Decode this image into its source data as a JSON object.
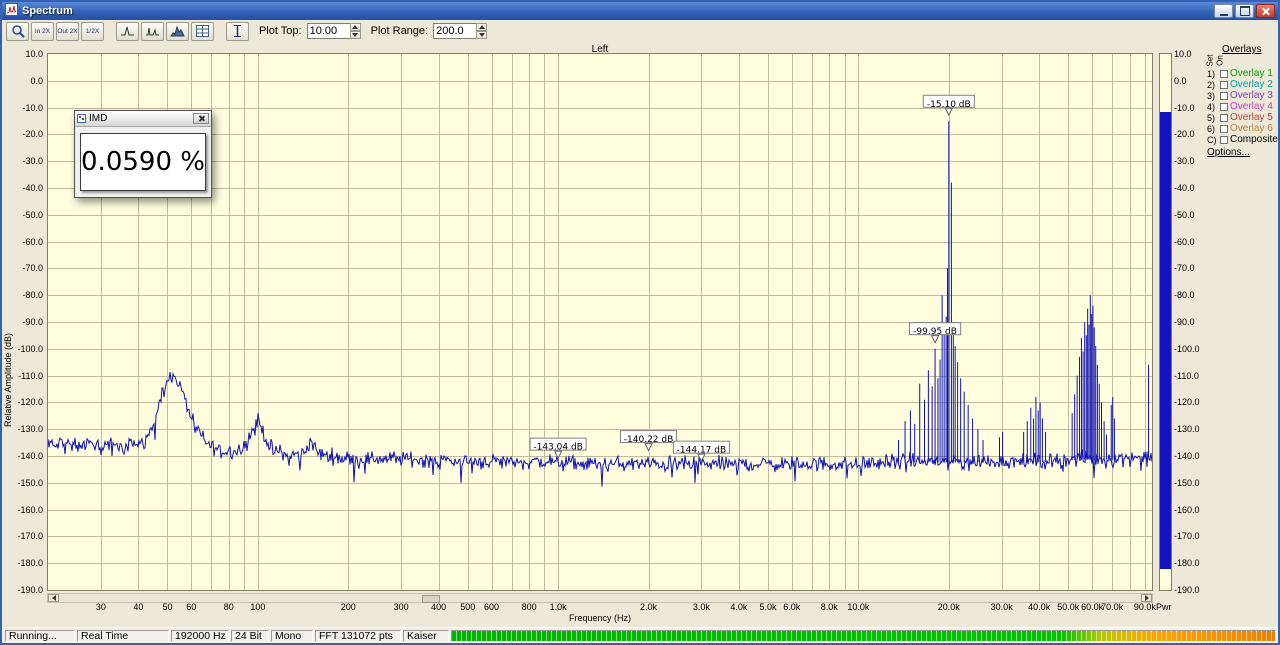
{
  "window": {
    "title": "Spectrum"
  },
  "icons": {
    "app": "spectrum-app-icon",
    "minimize": "minimize-icon",
    "maximize": "maximize-icon",
    "close": "close-icon",
    "zoom": "magnifier-icon",
    "zoom_in_2x": "magnifier-in-2x-icon",
    "zoom_out_2x": "magnifier-out-2x-icon",
    "zoom_half": "magnifier-half-icon",
    "peak_plot": "peak-curve-icon",
    "dual_peak_plot": "dual-peak-curve-icon",
    "filled_plot": "filled-curve-icon",
    "table": "data-table-icon",
    "cursor": "vertical-cursor-icon",
    "scroll_left": "arrow-left-icon",
    "scroll_right": "arrow-right-icon",
    "dialog_close": "close-icon"
  },
  "toolbar": {
    "zoom_in_label": "In 2X",
    "zoom_out_label": "Out 2X",
    "zoom_half_label": "1/2X",
    "plot_top_label": "Plot Top:",
    "plot_top_value": "10.00",
    "plot_range_label": "Plot Range:",
    "plot_range_value": "200.0"
  },
  "plot": {
    "title": "Left",
    "xlabel": "Frequency (Hz)",
    "ylabel": "Relative Amplitude (dB)",
    "pwr_label": "Pwr"
  },
  "imd_window": {
    "title": "IMD",
    "value": "0.0590 %"
  },
  "overlays": {
    "header": "Overlays",
    "col_set": "Set",
    "col_on": "On",
    "items": [
      {
        "num": "1)",
        "label": "Overlay 1",
        "color": "#00A000"
      },
      {
        "num": "2)",
        "label": "Overlay 2",
        "color": "#00A0A0"
      },
      {
        "num": "3)",
        "label": "Overlay 3",
        "color": "#8040C0"
      },
      {
        "num": "4)",
        "label": "Overlay 4",
        "color": "#C040C0"
      },
      {
        "num": "5)",
        "label": "Overlay 5",
        "color": "#C04040"
      },
      {
        "num": "6)",
        "label": "Overlay 6",
        "color": "#C08040"
      }
    ],
    "composite": {
      "num": "C)",
      "label": "Composite",
      "color": "#000000"
    },
    "options_label": "Options..."
  },
  "status": {
    "items": [
      "Running...",
      "Real Time",
      "192000 Hz",
      "24 Bit",
      "Mono",
      "FFT 131072 pts",
      "Kaiser"
    ]
  },
  "chart_data": {
    "type": "line",
    "title": "Left",
    "xlabel": "Frequency (Hz)",
    "ylabel": "Relative Amplitude (dB)",
    "xscale": "log",
    "xlim": [
      20,
      95000
    ],
    "ylim": [
      -190,
      10
    ],
    "plot_top_db": 10.0,
    "plot_range_db": 200.0,
    "grid": true,
    "colors": {
      "trace": "#1010B8",
      "grid": "#BEBE9C",
      "bg": "#FFFFE0",
      "power_bar": "#1212BE"
    },
    "y_ticks": [
      "10.0",
      "0.0",
      "-10.0",
      "-20.0",
      "-30.0",
      "-40.0",
      "-50.0",
      "-60.0",
      "-70.0",
      "-80.0",
      "-90.0",
      "-100.0",
      "-110.0",
      "-120.0",
      "-130.0",
      "-140.0",
      "-150.0",
      "-160.0",
      "-170.0",
      "-180.0",
      "-190.0"
    ],
    "x_ticks": [
      {
        "f": 30,
        "label": "30"
      },
      {
        "f": 40,
        "label": "40"
      },
      {
        "f": 50,
        "label": "50"
      },
      {
        "f": 60,
        "label": "60"
      },
      {
        "f": 80,
        "label": "80"
      },
      {
        "f": 100,
        "label": "100"
      },
      {
        "f": 200,
        "label": "200"
      },
      {
        "f": 300,
        "label": "300"
      },
      {
        "f": 400,
        "label": "400"
      },
      {
        "f": 500,
        "label": "500"
      },
      {
        "f": 600,
        "label": "600"
      },
      {
        "f": 800,
        "label": "800"
      },
      {
        "f": 1000,
        "label": "1.0k"
      },
      {
        "f": 2000,
        "label": "2.0k"
      },
      {
        "f": 3000,
        "label": "3.0k"
      },
      {
        "f": 4000,
        "label": "4.0k"
      },
      {
        "f": 5000,
        "label": "5.0k"
      },
      {
        "f": 6000,
        "label": "6.0k"
      },
      {
        "f": 8000,
        "label": "8.0k"
      },
      {
        "f": 10000,
        "label": "10.0k"
      },
      {
        "f": 20000,
        "label": "20.0k"
      },
      {
        "f": 30000,
        "label": "30.0k"
      },
      {
        "f": 40000,
        "label": "40.0k"
      },
      {
        "f": 50000,
        "label": "50.0k"
      },
      {
        "f": 60000,
        "label": "60.0k"
      },
      {
        "f": 70000,
        "label": "70.0k"
      },
      {
        "f": 90000,
        "label": "90.0k"
      }
    ],
    "noise_floor_db": [
      [
        20,
        -135
      ],
      [
        24,
        -136
      ],
      [
        30,
        -136
      ],
      [
        36,
        -137
      ],
      [
        42,
        -135
      ],
      [
        45,
        -129
      ],
      [
        47,
        -120
      ],
      [
        49,
        -113
      ],
      [
        51,
        -110.5
      ],
      [
        53,
        -111
      ],
      [
        55,
        -114
      ],
      [
        58,
        -121
      ],
      [
        62,
        -129
      ],
      [
        67,
        -135
      ],
      [
        75,
        -138
      ],
      [
        85,
        -138
      ],
      [
        92,
        -135
      ],
      [
        96,
        -130
      ],
      [
        100,
        -126.5
      ],
      [
        104,
        -131
      ],
      [
        110,
        -137
      ],
      [
        125,
        -140
      ],
      [
        143,
        -139
      ],
      [
        150,
        -134
      ],
      [
        158,
        -139
      ],
      [
        175,
        -140
      ],
      [
        200,
        -141
      ],
      [
        300,
        -141
      ],
      [
        500,
        -142
      ],
      [
        800,
        -142
      ],
      [
        1200,
        -143
      ],
      [
        3000,
        -143
      ],
      [
        6000,
        -143
      ],
      [
        10000,
        -143
      ],
      [
        14000,
        -142
      ],
      [
        20000,
        -142
      ],
      [
        28000,
        -142
      ],
      [
        40000,
        -142
      ],
      [
        55000,
        -141
      ],
      [
        70000,
        -141
      ],
      [
        95000,
        -140
      ]
    ],
    "peaks_db": [
      [
        13600,
        -134
      ],
      [
        14300,
        -127
      ],
      [
        14900,
        -123
      ],
      [
        15400,
        -128
      ],
      [
        16000,
        -113
      ],
      [
        16600,
        -119
      ],
      [
        17100,
        -108
      ],
      [
        17600,
        -114
      ],
      [
        18000,
        -99.95
      ],
      [
        18400,
        -111
      ],
      [
        18700,
        -104
      ],
      [
        19000,
        -80
      ],
      [
        19300,
        -93
      ],
      [
        19600,
        -88
      ],
      [
        19800,
        -70
      ],
      [
        20000,
        -15.1
      ],
      [
        20400,
        -38
      ],
      [
        20700,
        -90
      ],
      [
        21000,
        -99
      ],
      [
        21400,
        -105
      ],
      [
        21900,
        -111
      ],
      [
        22500,
        -116
      ],
      [
        23200,
        -121
      ],
      [
        24000,
        -126
      ],
      [
        25000,
        -130
      ],
      [
        26000,
        -134
      ],
      [
        29500,
        -133
      ],
      [
        30200,
        -131
      ],
      [
        35500,
        -131
      ],
      [
        36500,
        -127
      ],
      [
        37500,
        -122
      ],
      [
        38300,
        -126
      ],
      [
        39000,
        -118
      ],
      [
        39700,
        -123
      ],
      [
        40300,
        -120
      ],
      [
        41000,
        -126
      ],
      [
        42000,
        -131
      ],
      [
        51500,
        -124
      ],
      [
        52500,
        -117
      ],
      [
        53500,
        -110
      ],
      [
        54500,
        -103
      ],
      [
        55300,
        -96
      ],
      [
        56000,
        -101
      ],
      [
        56700,
        -90
      ],
      [
        57400,
        -95
      ],
      [
        58000,
        -85
      ],
      [
        58600,
        -91
      ],
      [
        59200,
        -80
      ],
      [
        59800,
        -87
      ],
      [
        60400,
        -84
      ],
      [
        61000,
        -92
      ],
      [
        61700,
        -99
      ],
      [
        62500,
        -106
      ],
      [
        63400,
        -113
      ],
      [
        64500,
        -120
      ],
      [
        65800,
        -127
      ],
      [
        67000,
        -132
      ],
      [
        69500,
        -121
      ],
      [
        70300,
        -118
      ],
      [
        71200,
        -126
      ],
      [
        92500,
        -106
      ]
    ],
    "markers": [
      {
        "label": "-15.10 dB",
        "f": 20000,
        "db": -15.1
      },
      {
        "label": "-99.95 dB",
        "f": 18000,
        "db": -99.95
      },
      {
        "label": "-143.04 dB",
        "f": 1000,
        "db": -143.04
      },
      {
        "label": "-140.22 dB",
        "f": 2000,
        "db": -140.22
      },
      {
        "label": "-144.17 dB",
        "f": 3000,
        "db": -144.17
      }
    ],
    "power_bar": {
      "top_db": -11.5,
      "bottom_db": -182
    }
  }
}
